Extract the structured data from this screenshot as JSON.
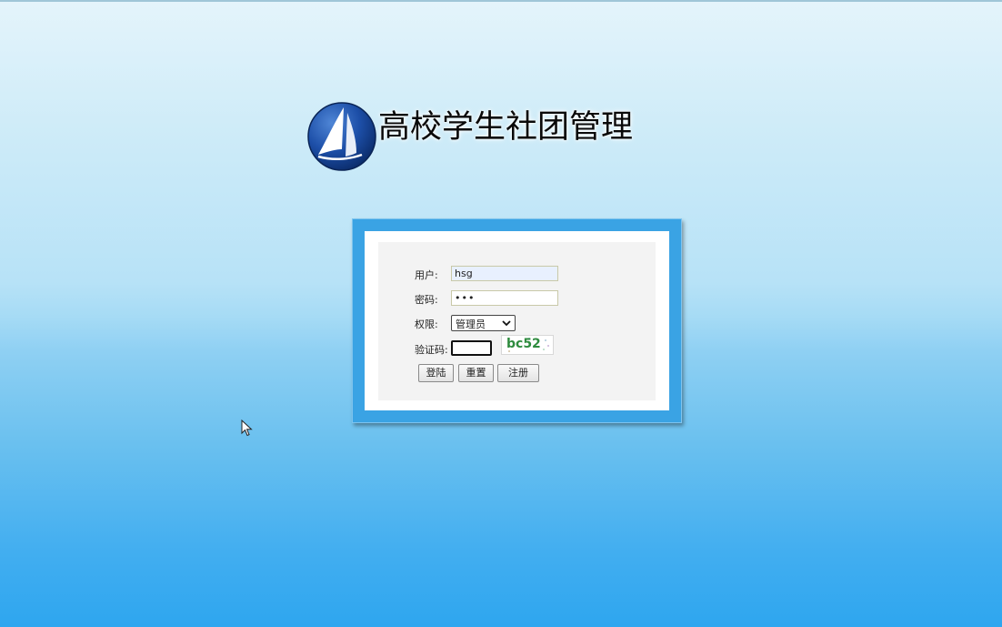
{
  "app": {
    "title": "高校学生社团管理"
  },
  "login_form": {
    "user_label": "用户:",
    "user_value": "hsg",
    "password_label": "密码:",
    "password_value": "•••",
    "role_label": "权限:",
    "role_selected": "管理员",
    "captcha_label": "验证码:",
    "captcha_value": "",
    "captcha_image_text": "bc52",
    "login_button": "登陆",
    "reset_button": "重置",
    "register_button": "注册"
  },
  "icons": {
    "logo": "sailboat-logo-icon",
    "select_arrow": "chevron-down-icon",
    "cursor": "mouse-pointer-icon"
  },
  "colors": {
    "panel_border": "#3aa3e4",
    "captcha_text": "#2e8b3e"
  }
}
